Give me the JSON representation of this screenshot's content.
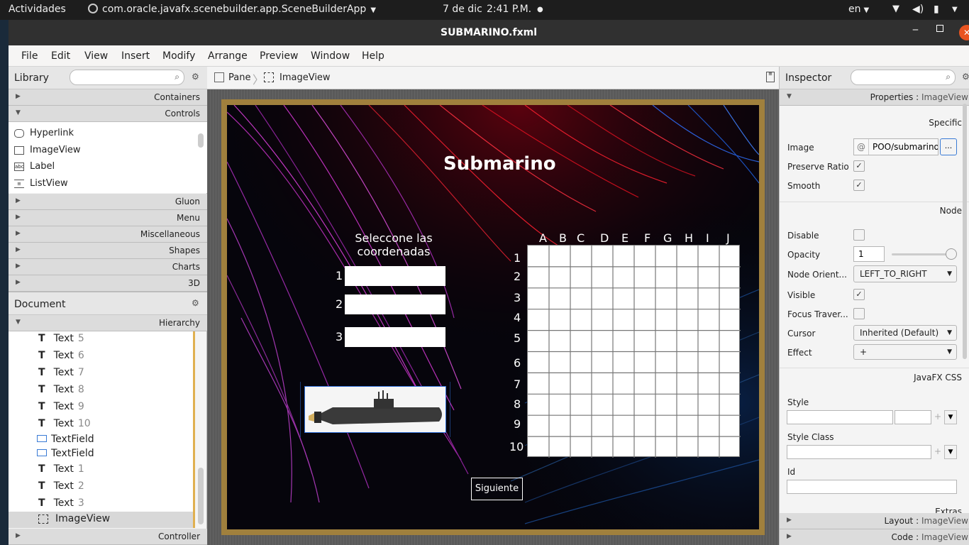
{
  "system_bar": {
    "activities": "Actividades",
    "app_name": "com.oracle.javafx.scenebuilder.app.SceneBuilderApp",
    "date": "7 de dic",
    "time": "2:41 P.M.",
    "lang": "en"
  },
  "window": {
    "title": "SUBMARINO.fxml"
  },
  "menu": [
    "File",
    "Edit",
    "View",
    "Insert",
    "Modify",
    "Arrange",
    "Preview",
    "Window",
    "Help"
  ],
  "library": {
    "title": "Library",
    "sections": [
      "Containers",
      "Controls",
      "Gluon",
      "Menu",
      "Miscellaneous",
      "Shapes",
      "Charts",
      "3D"
    ],
    "controls_items": [
      "Hyperlink",
      "ImageView",
      "Label",
      "ListView"
    ]
  },
  "document": {
    "title": "Document",
    "hierarchy_label": "Hierarchy",
    "items": [
      {
        "type": "Text",
        "num": "5"
      },
      {
        "type": "Text",
        "num": "6"
      },
      {
        "type": "Text",
        "num": "7"
      },
      {
        "type": "Text",
        "num": "8"
      },
      {
        "type": "Text",
        "num": "9"
      },
      {
        "type": "Text",
        "num": "10"
      },
      {
        "type": "TextField",
        "num": ""
      },
      {
        "type": "TextField",
        "num": ""
      },
      {
        "type": "Text",
        "num": "1"
      },
      {
        "type": "Text",
        "num": "2"
      },
      {
        "type": "Text",
        "num": "3"
      },
      {
        "type": "ImageView",
        "num": ""
      }
    ],
    "controller_label": "Controller"
  },
  "breadcrumb": {
    "root": "Pane",
    "child": "ImageView"
  },
  "scene": {
    "title": "Submarino",
    "prompt": "Seleccone las\ncoordenadas",
    "input_labels": [
      "1",
      "2",
      "3"
    ],
    "columns": [
      "A",
      "B",
      "C",
      "D",
      "E",
      "F",
      "G",
      "H",
      "I",
      "J"
    ],
    "rows": [
      "1",
      "2",
      "3",
      "4",
      "5",
      "6",
      "7",
      "8",
      "9",
      "10"
    ],
    "next_button": "Siguiente"
  },
  "inspector": {
    "title": "Inspector",
    "properties_header": "Properties",
    "properties_target": "ImageView",
    "specific_label": "Specific",
    "image_label": "Image",
    "image_at": "@",
    "image_value": "POO/submarino.",
    "image_browse": "...",
    "preserve_ratio_label": "Preserve Ratio",
    "preserve_ratio": true,
    "smooth_label": "Smooth",
    "smooth": true,
    "node_label": "Node",
    "disable_label": "Disable",
    "disable": false,
    "opacity_label": "Opacity",
    "opacity_value": "1",
    "opacity_level": 1.0,
    "node_orient_label": "Node Orient...",
    "node_orient_value": "LEFT_TO_RIGHT",
    "visible_label": "Visible",
    "visible": true,
    "focus_traversable_label": "Focus Traver...",
    "focus_traversable": false,
    "cursor_label": "Cursor",
    "cursor_value": "Inherited (Default)",
    "effect_label": "Effect",
    "effect_value": "+",
    "javafx_css_label": "JavaFX CSS",
    "style_label": "Style",
    "style_class_label": "Style Class",
    "id_label": "Id",
    "extras_label": "Extras",
    "layout_header": "Layout",
    "layout_target": "ImageView",
    "code_header": "Code",
    "code_target": "ImageView"
  }
}
